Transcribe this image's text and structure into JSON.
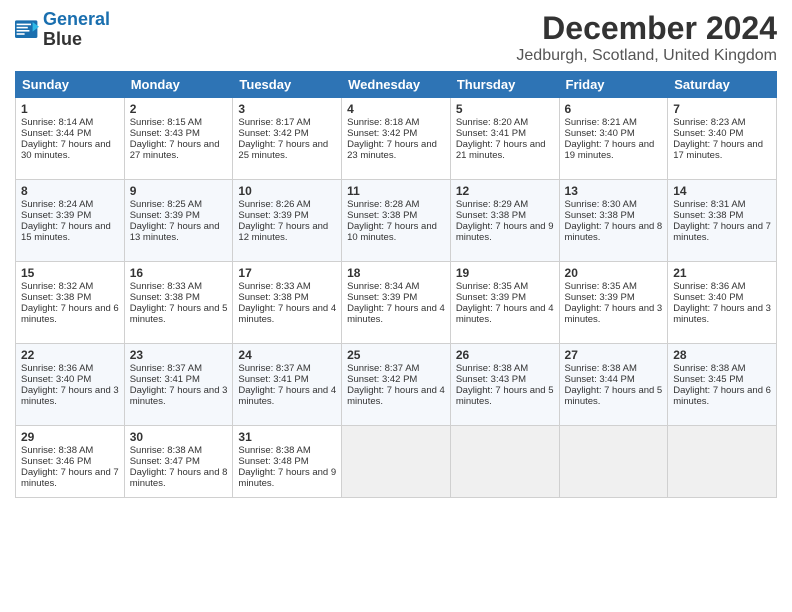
{
  "logo": {
    "line1": "General",
    "line2": "Blue"
  },
  "title": "December 2024",
  "location": "Jedburgh, Scotland, United Kingdom",
  "days_of_week": [
    "Sunday",
    "Monday",
    "Tuesday",
    "Wednesday",
    "Thursday",
    "Friday",
    "Saturday"
  ],
  "weeks": [
    [
      {
        "day": "1",
        "sunrise": "Sunrise: 8:14 AM",
        "sunset": "Sunset: 3:44 PM",
        "daylight": "Daylight: 7 hours and 30 minutes."
      },
      {
        "day": "2",
        "sunrise": "Sunrise: 8:15 AM",
        "sunset": "Sunset: 3:43 PM",
        "daylight": "Daylight: 7 hours and 27 minutes."
      },
      {
        "day": "3",
        "sunrise": "Sunrise: 8:17 AM",
        "sunset": "Sunset: 3:42 PM",
        "daylight": "Daylight: 7 hours and 25 minutes."
      },
      {
        "day": "4",
        "sunrise": "Sunrise: 8:18 AM",
        "sunset": "Sunset: 3:42 PM",
        "daylight": "Daylight: 7 hours and 23 minutes."
      },
      {
        "day": "5",
        "sunrise": "Sunrise: 8:20 AM",
        "sunset": "Sunset: 3:41 PM",
        "daylight": "Daylight: 7 hours and 21 minutes."
      },
      {
        "day": "6",
        "sunrise": "Sunrise: 8:21 AM",
        "sunset": "Sunset: 3:40 PM",
        "daylight": "Daylight: 7 hours and 19 minutes."
      },
      {
        "day": "7",
        "sunrise": "Sunrise: 8:23 AM",
        "sunset": "Sunset: 3:40 PM",
        "daylight": "Daylight: 7 hours and 17 minutes."
      }
    ],
    [
      {
        "day": "8",
        "sunrise": "Sunrise: 8:24 AM",
        "sunset": "Sunset: 3:39 PM",
        "daylight": "Daylight: 7 hours and 15 minutes."
      },
      {
        "day": "9",
        "sunrise": "Sunrise: 8:25 AM",
        "sunset": "Sunset: 3:39 PM",
        "daylight": "Daylight: 7 hours and 13 minutes."
      },
      {
        "day": "10",
        "sunrise": "Sunrise: 8:26 AM",
        "sunset": "Sunset: 3:39 PM",
        "daylight": "Daylight: 7 hours and 12 minutes."
      },
      {
        "day": "11",
        "sunrise": "Sunrise: 8:28 AM",
        "sunset": "Sunset: 3:38 PM",
        "daylight": "Daylight: 7 hours and 10 minutes."
      },
      {
        "day": "12",
        "sunrise": "Sunrise: 8:29 AM",
        "sunset": "Sunset: 3:38 PM",
        "daylight": "Daylight: 7 hours and 9 minutes."
      },
      {
        "day": "13",
        "sunrise": "Sunrise: 8:30 AM",
        "sunset": "Sunset: 3:38 PM",
        "daylight": "Daylight: 7 hours and 8 minutes."
      },
      {
        "day": "14",
        "sunrise": "Sunrise: 8:31 AM",
        "sunset": "Sunset: 3:38 PM",
        "daylight": "Daylight: 7 hours and 7 minutes."
      }
    ],
    [
      {
        "day": "15",
        "sunrise": "Sunrise: 8:32 AM",
        "sunset": "Sunset: 3:38 PM",
        "daylight": "Daylight: 7 hours and 6 minutes."
      },
      {
        "day": "16",
        "sunrise": "Sunrise: 8:33 AM",
        "sunset": "Sunset: 3:38 PM",
        "daylight": "Daylight: 7 hours and 5 minutes."
      },
      {
        "day": "17",
        "sunrise": "Sunrise: 8:33 AM",
        "sunset": "Sunset: 3:38 PM",
        "daylight": "Daylight: 7 hours and 4 minutes."
      },
      {
        "day": "18",
        "sunrise": "Sunrise: 8:34 AM",
        "sunset": "Sunset: 3:39 PM",
        "daylight": "Daylight: 7 hours and 4 minutes."
      },
      {
        "day": "19",
        "sunrise": "Sunrise: 8:35 AM",
        "sunset": "Sunset: 3:39 PM",
        "daylight": "Daylight: 7 hours and 4 minutes."
      },
      {
        "day": "20",
        "sunrise": "Sunrise: 8:35 AM",
        "sunset": "Sunset: 3:39 PM",
        "daylight": "Daylight: 7 hours and 3 minutes."
      },
      {
        "day": "21",
        "sunrise": "Sunrise: 8:36 AM",
        "sunset": "Sunset: 3:40 PM",
        "daylight": "Daylight: 7 hours and 3 minutes."
      }
    ],
    [
      {
        "day": "22",
        "sunrise": "Sunrise: 8:36 AM",
        "sunset": "Sunset: 3:40 PM",
        "daylight": "Daylight: 7 hours and 3 minutes."
      },
      {
        "day": "23",
        "sunrise": "Sunrise: 8:37 AM",
        "sunset": "Sunset: 3:41 PM",
        "daylight": "Daylight: 7 hours and 3 minutes."
      },
      {
        "day": "24",
        "sunrise": "Sunrise: 8:37 AM",
        "sunset": "Sunset: 3:41 PM",
        "daylight": "Daylight: 7 hours and 4 minutes."
      },
      {
        "day": "25",
        "sunrise": "Sunrise: 8:37 AM",
        "sunset": "Sunset: 3:42 PM",
        "daylight": "Daylight: 7 hours and 4 minutes."
      },
      {
        "day": "26",
        "sunrise": "Sunrise: 8:38 AM",
        "sunset": "Sunset: 3:43 PM",
        "daylight": "Daylight: 7 hours and 5 minutes."
      },
      {
        "day": "27",
        "sunrise": "Sunrise: 8:38 AM",
        "sunset": "Sunset: 3:44 PM",
        "daylight": "Daylight: 7 hours and 5 minutes."
      },
      {
        "day": "28",
        "sunrise": "Sunrise: 8:38 AM",
        "sunset": "Sunset: 3:45 PM",
        "daylight": "Daylight: 7 hours and 6 minutes."
      }
    ],
    [
      {
        "day": "29",
        "sunrise": "Sunrise: 8:38 AM",
        "sunset": "Sunset: 3:46 PM",
        "daylight": "Daylight: 7 hours and 7 minutes."
      },
      {
        "day": "30",
        "sunrise": "Sunrise: 8:38 AM",
        "sunset": "Sunset: 3:47 PM",
        "daylight": "Daylight: 7 hours and 8 minutes."
      },
      {
        "day": "31",
        "sunrise": "Sunrise: 8:38 AM",
        "sunset": "Sunset: 3:48 PM",
        "daylight": "Daylight: 7 hours and 9 minutes."
      },
      null,
      null,
      null,
      null
    ]
  ]
}
